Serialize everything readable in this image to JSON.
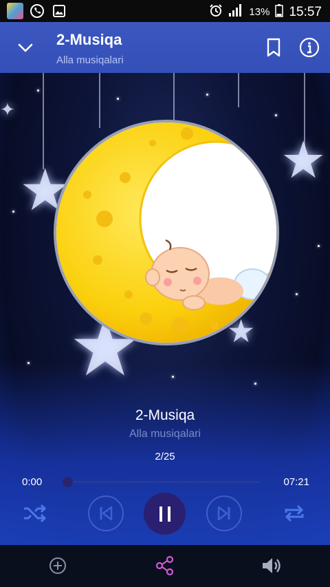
{
  "status_bar": {
    "battery_percent": "13%",
    "time": "15:57",
    "icons": [
      "gallery-app-icon",
      "whatsapp-icon",
      "image-icon",
      "alarm-icon",
      "signal-icon",
      "battery-icon"
    ]
  },
  "app_bar": {
    "title": "2-Musiqa",
    "subtitle": "Alla musiqalari",
    "icons": [
      "chevron-down-icon",
      "bookmark-icon",
      "info-icon"
    ]
  },
  "now_playing": {
    "title": "2-Musiqa",
    "artist": "Alla musiqalari",
    "track_index": "2/25",
    "current_time": "0:00",
    "total_time": "07:21",
    "progress": 0.0
  },
  "controls": [
    "shuffle-icon",
    "previous-icon",
    "pause-icon",
    "next-icon",
    "repeat-icon"
  ],
  "bottom_bar": [
    "add-icon",
    "share-icon",
    "volume-icon"
  ],
  "colors": {
    "app_bar": "#3450b8",
    "play_button": "#2b1f72",
    "control_icons": "#4a78e8",
    "share_icon": "#d05ad0"
  }
}
